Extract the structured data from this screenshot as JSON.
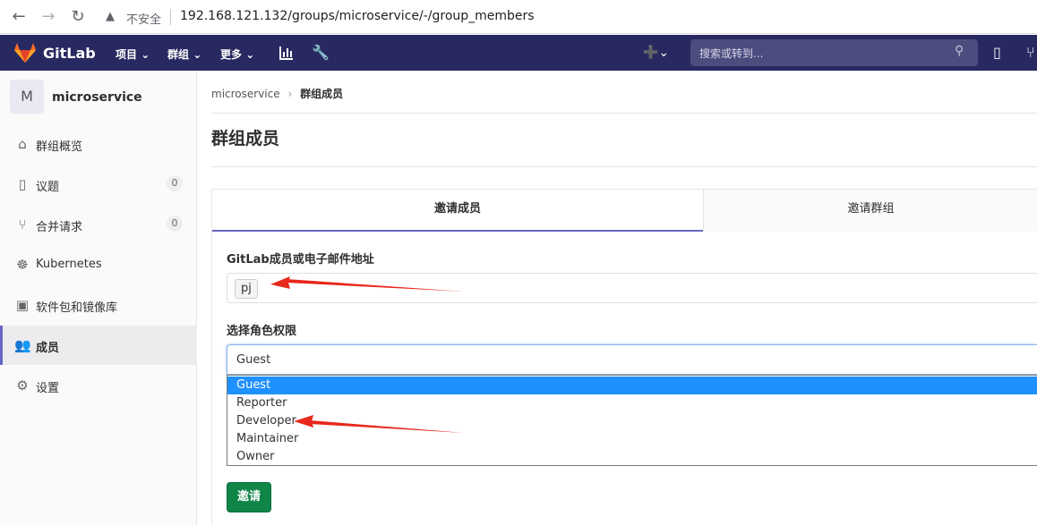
{
  "browser": {
    "back_icon": "←",
    "forward_icon": "→",
    "reload_icon": "↻",
    "warning_icon": "▲",
    "insecure_label": "不安全",
    "url": "192.168.121.132/groups/microservice/-/group_members"
  },
  "header": {
    "brand": "GitLab",
    "menu": [
      "项目",
      "群组",
      "更多"
    ],
    "search_placeholder": "搜索或转到...",
    "colors": {
      "bar": "#292961",
      "logo": "#fc6d26"
    }
  },
  "sidebar": {
    "avatar_letter": "M",
    "group_name": "microservice",
    "items": [
      {
        "label": "群组概览",
        "icon": "home-icon"
      },
      {
        "label": "议题",
        "icon": "issues-icon",
        "count": "0"
      },
      {
        "label": "合并请求",
        "icon": "merge-request-icon",
        "count": "0"
      },
      {
        "label": "Kubernetes",
        "icon": "kubernetes-icon"
      },
      {
        "label": "软件包和镜像库",
        "icon": "package-icon"
      },
      {
        "label": "成员",
        "icon": "users-icon",
        "active": true
      },
      {
        "label": "设置",
        "icon": "gear-icon"
      }
    ]
  },
  "breadcrumb": {
    "group": "microservice",
    "current": "群组成员"
  },
  "page_title": "群组成员",
  "tabs": [
    "邀请成员",
    "邀请群组"
  ],
  "form": {
    "member_label": "GitLab成员或电子邮件地址",
    "member_token": "pj",
    "role_label": "选择角色权限",
    "role_selected": "Guest",
    "role_options": [
      "Guest",
      "Reporter",
      "Developer",
      "Maintainer",
      "Owner"
    ],
    "invite_button": "邀请"
  }
}
